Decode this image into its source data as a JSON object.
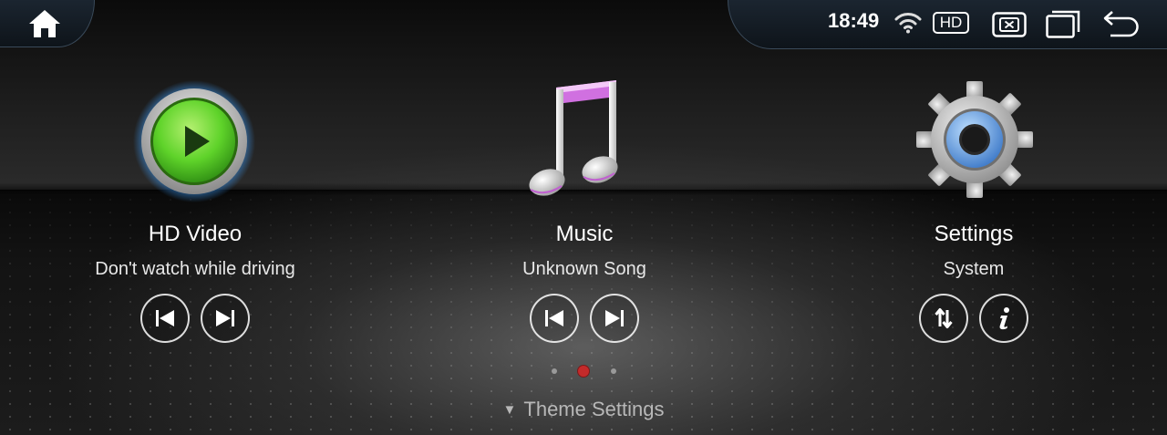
{
  "status_bar": {
    "time": "18:49",
    "hd_badge": "HD",
    "icons": [
      "home-icon",
      "wifi-icon",
      "hd-badge",
      "close-window-icon",
      "recent-apps-icon",
      "back-icon"
    ]
  },
  "apps": [
    {
      "title": "HD Video",
      "subtitle": "Don't watch while driving",
      "icon": "play-icon",
      "controls": [
        "previous-icon",
        "next-icon"
      ]
    },
    {
      "title": "Music",
      "subtitle": "Unknown Song",
      "icon": "music-note-icon",
      "controls": [
        "previous-icon",
        "next-icon"
      ]
    },
    {
      "title": "Settings",
      "subtitle": "System",
      "icon": "gear-icon",
      "controls": [
        "sort-icon",
        "info-icon"
      ]
    }
  ],
  "pagination": {
    "pages": 3,
    "active": 2,
    "active_color": "#c42a2a"
  },
  "footer": {
    "theme_label": "Theme Settings"
  },
  "colors": {
    "accent_blue": "#3fa0ff",
    "play_green": "#5fd32a",
    "music_pink": "#d070e0"
  }
}
